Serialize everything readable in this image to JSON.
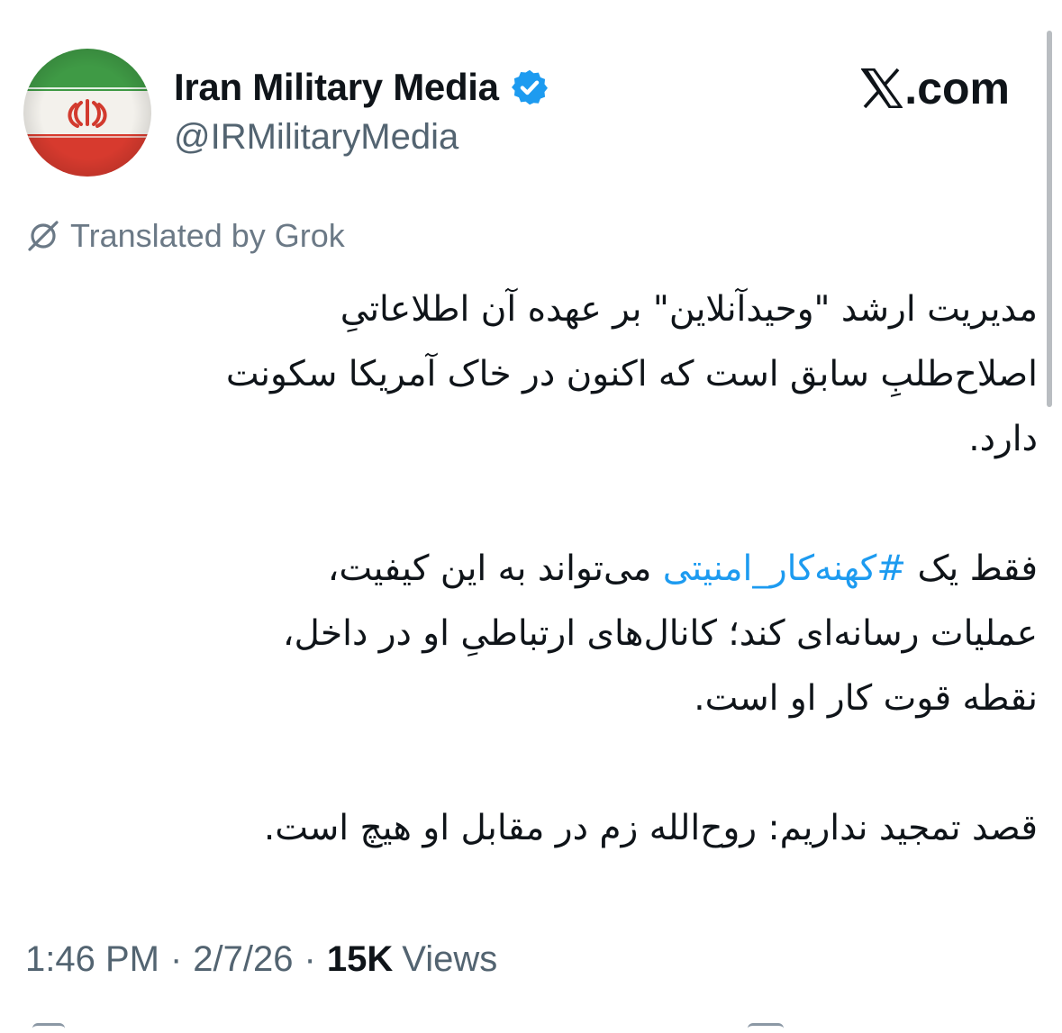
{
  "author": {
    "display_name": "Iran Military Media",
    "handle": "@IRMilitaryMedia",
    "verified": true,
    "avatar_icon": "iran-flag-icon"
  },
  "brand": {
    "logo_text": ".com",
    "logo_icon": "x-logo-icon"
  },
  "translation": {
    "label": "Translated by Grok",
    "icon": "grok-icon"
  },
  "tweet": {
    "p1_line1": "مدیریت ارشد \"وحیدآنلاین\" بر عهده آن اطلاعاتیِ",
    "p1_line2": "اصلاح‌طلبِ سابق است که اکنون در خاک آمریکا سکونت",
    "p1_line3": "دارد.",
    "p2_before": "فقط یک",
    "p2_hashtag": "#کهنه‌کار_امنیتی",
    "p2_after": "می‌تواند به این کیفیت،",
    "p2_line2": "عملیات رسانه‌ای کند؛ کانال‌های ارتباطیِ او در داخل،",
    "p2_line3": "نقطه قوت کار او است.",
    "p3_line1": "قصد تمجید نداریم: روح‌الله زم در مقابل او هیچ است."
  },
  "meta": {
    "time": "1:46 PM",
    "separator": "·",
    "date": "2/7/26",
    "views_count": "15K",
    "views_label": "Views"
  },
  "colors": {
    "text": "#0f1419",
    "secondary": "#536471",
    "link": "#1d9bf0",
    "verified": "#1d9bf0"
  }
}
